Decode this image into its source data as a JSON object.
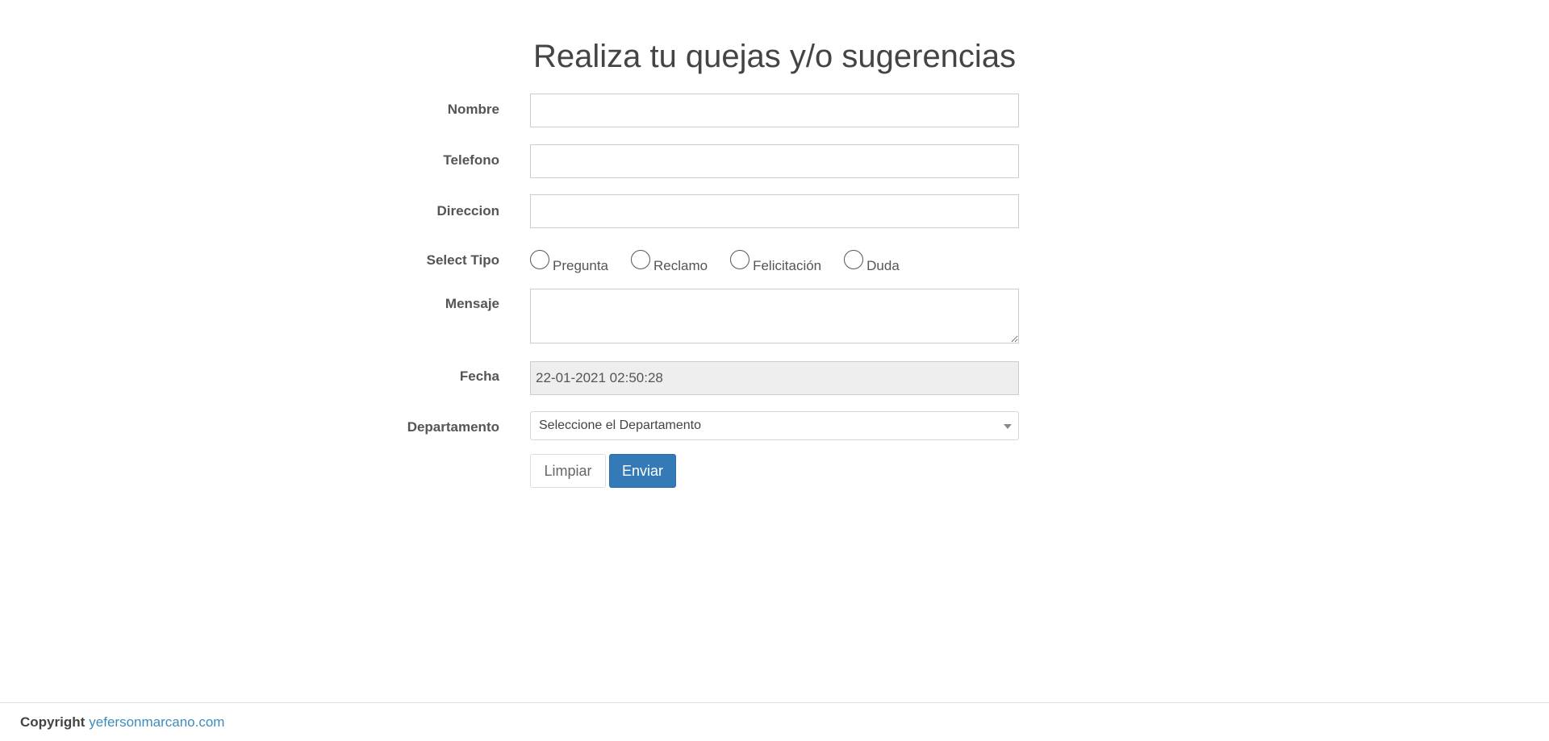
{
  "title": "Realiza tu quejas y/o sugerencias",
  "form": {
    "nombre": {
      "label": "Nombre",
      "value": ""
    },
    "telefono": {
      "label": "Telefono",
      "value": ""
    },
    "direccion": {
      "label": "Direccion",
      "value": ""
    },
    "tipo": {
      "label": "Select Tipo",
      "options": [
        "Pregunta",
        "Reclamo",
        "Felicitación",
        "Duda"
      ]
    },
    "mensaje": {
      "label": "Mensaje",
      "value": ""
    },
    "fecha": {
      "label": "Fecha",
      "value": "22-01-2021 02:50:28"
    },
    "departamento": {
      "label": "Departamento",
      "selected": "Seleccione el Departamento"
    }
  },
  "buttons": {
    "reset_label": "Limpiar",
    "submit_label": "Enviar"
  },
  "footer": {
    "copyright_label": "Copyright",
    "link_text": "yefersonmarcano.com"
  },
  "colors": {
    "primary": "#337ab7",
    "link": "#3c8dbc",
    "readonly_bg": "#eeeeee"
  }
}
